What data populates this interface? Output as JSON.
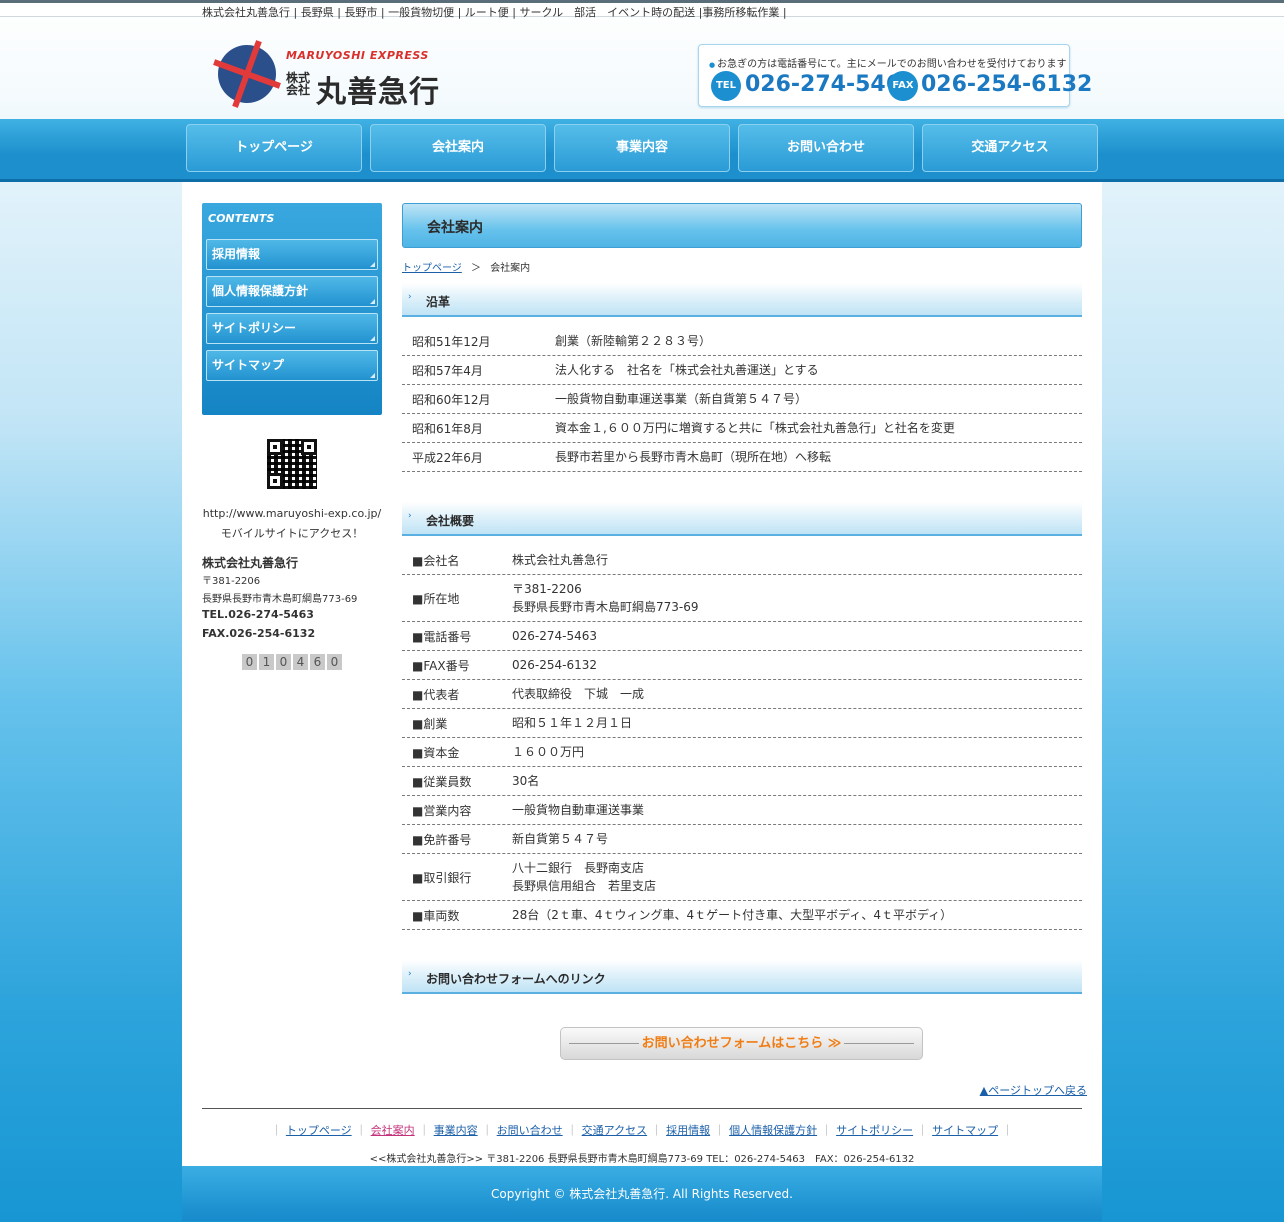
{
  "topstrip": {
    "text": "株式会社丸善急行 | 長野県 | 長野市 | 一般貨物切便 | ルート便 | サークル　部活　イベント時の配送 |事務所移転作業 |"
  },
  "logo": {
    "en": "MARUYOSHI EXPRESS",
    "kabushiki": "株式会社",
    "name": "丸善急行"
  },
  "contact": {
    "note": "お急ぎの方は電話番号にて。主にメールでのお問い合わせを受付けております",
    "tel_label": "TEL",
    "tel": "026-274-5463",
    "fax_label": "FAX",
    "fax": "026-254-6132"
  },
  "nav": [
    "トップページ",
    "会社案内",
    "事業内容",
    "お問い合わせ",
    "交通アクセス"
  ],
  "sidebar": {
    "heading": "CONTENTS",
    "items": [
      "採用情報",
      "個人情報保護方針",
      "サイトポリシー",
      "サイトマップ"
    ],
    "mobile_url": "http://www.maruyoshi-exp.co.jp/",
    "mobile_text": "モバイルサイトにアクセス！",
    "company": "株式会社丸善急行",
    "postal": "〒381-2206",
    "address": "長野県長野市青木島町綱島773-69",
    "tel": "TEL.026-274-5463",
    "fax": "FAX.026-254-6132",
    "counter": [
      "0",
      "1",
      "0",
      "4",
      "6",
      "0"
    ]
  },
  "main": {
    "title": "会社案内",
    "breadcrumb": {
      "home": "トップページ",
      "sep": "＞",
      "current": "会社案内"
    },
    "history_heading": "沿革",
    "history": [
      {
        "date": "昭和51年12月",
        "text": "創業（新陸輸第２２８３号）"
      },
      {
        "date": "昭和57年4月",
        "text": "法人化する　社名を「株式会社丸善運送」とする"
      },
      {
        "date": "昭和60年12月",
        "text": "一般貨物自動車運送事業（新自貨第５４７号）"
      },
      {
        "date": "昭和61年8月",
        "text": "資本金１,６００万円に増資すると共に「株式会社丸善急行」と社名を変更"
      },
      {
        "date": "平成22年6月",
        "text": "長野市若里から長野市青木島町（現所在地）へ移転"
      }
    ],
    "overview_heading": "会社概要",
    "overview": [
      {
        "label": "■会社名",
        "lines": [
          "株式会社丸善急行"
        ]
      },
      {
        "label": "■所在地",
        "lines": [
          "〒381-2206",
          "長野県長野市青木島町綱島773-69"
        ]
      },
      {
        "label": "■電話番号",
        "lines": [
          "026-274-5463"
        ]
      },
      {
        "label": "■FAX番号",
        "lines": [
          "026-254-6132"
        ]
      },
      {
        "label": "■代表者",
        "lines": [
          "代表取締役　下城　一成"
        ]
      },
      {
        "label": "■創業",
        "lines": [
          "昭和５１年１２月１日"
        ]
      },
      {
        "label": "■資本金",
        "lines": [
          "１６００万円"
        ]
      },
      {
        "label": "■従業員数",
        "lines": [
          "30名"
        ]
      },
      {
        "label": "■営業内容",
        "lines": [
          "一般貨物自動車運送事業"
        ]
      },
      {
        "label": "■免許番号",
        "lines": [
          "新自貨第５４７号"
        ]
      },
      {
        "label": "■取引銀行",
        "lines": [
          "八十二銀行　長野南支店",
          "長野県信用組合　若里支店"
        ]
      },
      {
        "label": "■車両数",
        "lines": [
          "28台（2ｔ車、4ｔウィング車、4ｔゲート付き車、大型平ボディ、4ｔ平ボディ）"
        ]
      }
    ],
    "form_heading": "お問い合わせフォームへのリンク",
    "form_button": "お問い合わせフォームはこちら ≫",
    "pagetop": "▲ページトップへ戻る"
  },
  "footer": {
    "links": [
      "トップページ",
      "会社案内",
      "事業内容",
      "お問い合わせ",
      "交通アクセス",
      "採用情報",
      "個人情報保護方針",
      "サイトポリシー",
      "サイトマップ"
    ],
    "address": "<<株式会社丸善急行>> 〒381-2206 長野県長野市青木島町綱島773-69 TEL：026-274-5463　FAX：026-254-6132",
    "copyright": "Copyright © 株式会社丸善急行. All Rights Reserved."
  },
  "colors": {
    "accent": "#1b8fd0",
    "nav": "#2a9bd6",
    "form_button_text": "#f07d14",
    "current_link": "#c2317a"
  }
}
